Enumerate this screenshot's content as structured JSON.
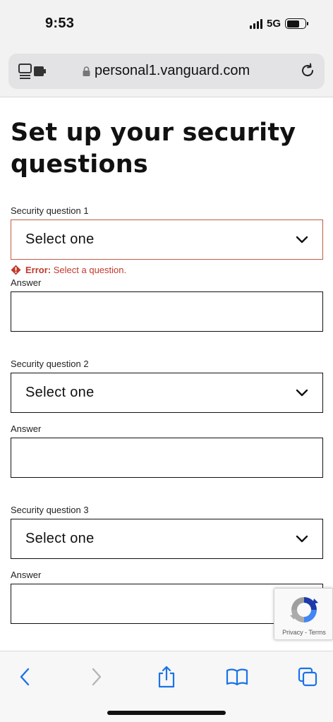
{
  "status_bar": {
    "time": "9:53",
    "network": "5G"
  },
  "browser": {
    "url": "personal1.vanguard.com"
  },
  "page": {
    "title": "Set up your security questions",
    "questions": [
      {
        "label": "Security question 1",
        "select_value": "Select one",
        "answer_label": "Answer",
        "error_prefix": "Error:",
        "error_text": "Select a question."
      },
      {
        "label": "Security question 2",
        "select_value": "Select one",
        "answer_label": "Answer"
      },
      {
        "label": "Security question 3",
        "select_value": "Select one",
        "answer_label": "Answer"
      }
    ]
  },
  "recaptcha": {
    "links": "Privacy - Terms"
  },
  "colors": {
    "error": "#c0392b",
    "accent": "#1a73e8",
    "error_border": "#c35a45"
  },
  "icons": {
    "tabs": "tabs-icon",
    "lock": "lock-icon",
    "reload": "reload-icon",
    "chevron": "chevron-down-icon",
    "error": "error-diamond-icon",
    "back": "back-chevron-icon",
    "forward": "forward-chevron-icon",
    "share": "share-icon",
    "bookmarks": "book-icon",
    "tab_switcher": "tabs-overview-icon"
  }
}
